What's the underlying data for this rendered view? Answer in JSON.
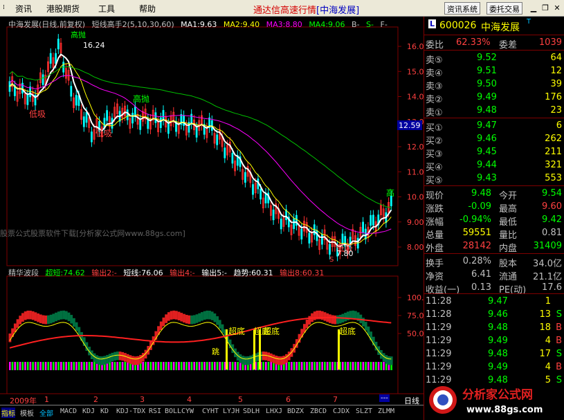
{
  "menu": {
    "items": [
      "资讯",
      "港股期货",
      "工具",
      "帮助"
    ],
    "title": "通达信高速行情",
    "title_tag": "[中海发展]",
    "btn_info": "资讯系统",
    "btn_trade": "委托交易"
  },
  "chart_header": {
    "name": "中海发展(日线,前复权)",
    "indicator": "短线高手2(5,10,30,60)",
    "ma1": "MA1:9.63",
    "ma2": "MA2:9.40",
    "ma3": "MA3:8.80",
    "ma4": "MA4:9.06",
    "b": "B-",
    "s": "S-",
    "f": "F-"
  },
  "annotations": {
    "top_high": "高抛",
    "top_price": "16.24",
    "low_buy1": "低吸",
    "high_sell2": "高抛",
    "low_buy2": "低吸",
    "low_buy3": "低吸",
    "bottom_price": "7.80",
    "high_right": "高",
    "s_mark": "S",
    "current_price": "12.59"
  },
  "price_axis": [
    "16.00",
    "15.00",
    "14.00",
    "13.00",
    "12.00",
    "11.00",
    "10.00",
    "9.00",
    "8.00"
  ],
  "sub_header": {
    "name": "精华波段",
    "chao_duan": "超短:74.62",
    "out2": "输出2:-",
    "duan_xian": "短线:76.06",
    "out4": "输出4:-",
    "out5": "输出5:-",
    "trend": "趋势:60.31",
    "out8": "输出8:60.31"
  },
  "sub_axis": [
    "100.0",
    "75.00",
    "50.00"
  ],
  "sub_labels": {
    "chaodi1": "超底",
    "chaodi2": "超底",
    "chaodi3": "超底",
    "chaodi4": "超底",
    "tiao": "跳"
  },
  "time_axis": {
    "year": "2009年",
    "months": [
      "1",
      "2",
      "3",
      "4",
      "5",
      "6",
      "7"
    ],
    "dash": "---",
    "period": "日线"
  },
  "tabs": [
    "指标",
    "模板",
    "全部",
    "MACD",
    "KDJ",
    "KD",
    "KDJ-TDX",
    "RSI",
    "BOLL",
    "CYW",
    "CYHT",
    "LYJH",
    "SDLH",
    "LHXJ",
    "BDZX",
    "ZBCD",
    "CJDX",
    "SLZT",
    "ZLMM"
  ],
  "watermark": "股票公式股票软件下载[分析家公式网www.88gs.com]",
  "quote": {
    "code": "600026",
    "name": "中海发展",
    "weibi_label": "委比",
    "weibi": "62.33%",
    "weicha_label": "委差",
    "weicha": "1039",
    "asks": [
      {
        "label": "卖⑤",
        "price": "9.52",
        "vol": "64"
      },
      {
        "label": "卖④",
        "price": "9.51",
        "vol": "12"
      },
      {
        "label": "卖③",
        "price": "9.50",
        "vol": "39"
      },
      {
        "label": "卖②",
        "price": "9.49",
        "vol": "176"
      },
      {
        "label": "卖①",
        "price": "9.48",
        "vol": "23"
      }
    ],
    "bids": [
      {
        "label": "买①",
        "price": "9.47",
        "vol": "6"
      },
      {
        "label": "买②",
        "price": "9.46",
        "vol": "262"
      },
      {
        "label": "买③",
        "price": "9.45",
        "vol": "211"
      },
      {
        "label": "买④",
        "price": "9.44",
        "vol": "321"
      },
      {
        "label": "买⑤",
        "price": "9.43",
        "vol": "553"
      }
    ],
    "stats": [
      {
        "l1": "现价",
        "v1": "9.48",
        "l2": "今开",
        "v2": "9.54"
      },
      {
        "l1": "涨跌",
        "v1": "-0.09",
        "l2": "最高",
        "v2": "9.60"
      },
      {
        "l1": "涨幅",
        "v1": "-0.94%",
        "l2": "最低",
        "v2": "9.42"
      },
      {
        "l1": "总量",
        "v1": "59551",
        "l2": "量比",
        "v2": "0.81"
      },
      {
        "l1": "外盘",
        "v1": "28142",
        "l2": "内盘",
        "v2": "31409"
      }
    ],
    "stats2": [
      {
        "l1": "换手",
        "v1": "0.28%",
        "l2": "股本",
        "v2": "34.0亿"
      },
      {
        "l1": "净资",
        "v1": "6.41",
        "l2": "流通",
        "v2": "21.1亿"
      },
      {
        "l1": "收益(一)",
        "v1": "0.13",
        "l2": "PE(动)",
        "v2": "17.6"
      }
    ],
    "ticks": [
      {
        "time": "11:28",
        "price": "9.47",
        "vol": "1",
        "side": ""
      },
      {
        "time": "11:28",
        "price": "9.46",
        "vol": "13",
        "side": "S"
      },
      {
        "time": "11:29",
        "price": "9.48",
        "vol": "18",
        "side": "B"
      },
      {
        "time": "11:29",
        "price": "9.49",
        "vol": "4",
        "side": "B"
      },
      {
        "time": "11:29",
        "price": "9.48",
        "vol": "17",
        "side": "S"
      },
      {
        "time": "11:29",
        "price": "9.49",
        "vol": "4",
        "side": "B"
      },
      {
        "time": "11:29",
        "price": "9.48",
        "vol": "5",
        "side": "S"
      }
    ]
  },
  "logo": {
    "text": "分析家公式网",
    "url": "www.88gs.com"
  }
}
